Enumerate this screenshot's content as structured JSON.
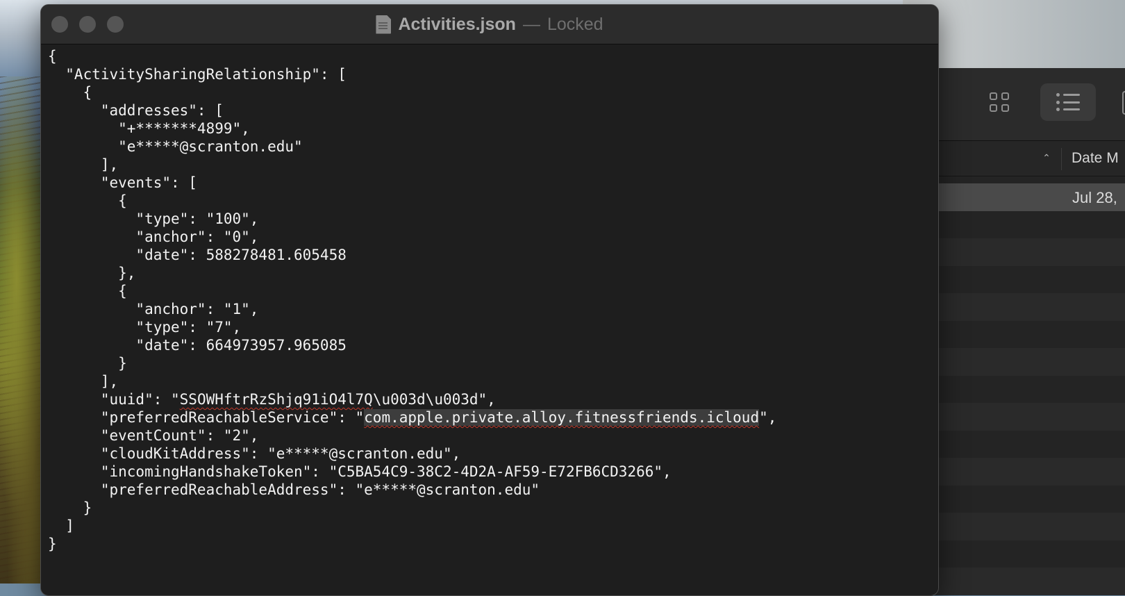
{
  "window": {
    "file_name": "Activities.json",
    "separator": "—",
    "state": "Locked",
    "icon": "document-icon"
  },
  "document": {
    "lines": [
      "{",
      "  \"ActivitySharingRelationship\": [",
      "    {",
      "      \"addresses\": [",
      "        \"+*******4899\",",
      "        \"e*****@scranton.edu\"",
      "      ],",
      "      \"events\": [",
      "        {",
      "          \"type\": \"100\",",
      "          \"anchor\": \"0\",",
      "          \"date\": 588278481.605458",
      "        },",
      "        {",
      "          \"anchor\": \"1\",",
      "          \"type\": \"7\",",
      "          \"date\": 664973957.965085",
      "        }",
      "      ],",
      "      \"uuid\": \"SSOWHftrRzShjq91iO4l7Q\\u003d\\u003d\",",
      "      \"preferredReachableService\": \"com.apple.private.alloy.fitnessfriends.icloud\",",
      "      \"eventCount\": \"2\",",
      "      \"cloudKitAddress\": \"e*****@scranton.edu\",",
      "      \"incomingHandshakeToken\": \"C5BA54C9-38C2-4D2A-AF59-E72FB6CD3266\",",
      "      \"preferredReachableAddress\": \"e*****@scranton.edu\"",
      "    }",
      "  ]",
      "}"
    ],
    "uuid_line": {
      "prefix": "      \"uuid\": \"",
      "misspelled": "SSOWHftrRzShjq91iO4l7Q",
      "suffix": "\\u003d\\u003d\","
    },
    "service_line": {
      "prefix": "      \"preferredReachableService\": \"",
      "selected": "com.apple.private.alloy.fitnessfriends.icloud",
      "suffix": "\","
    }
  },
  "finder": {
    "toolbar": {
      "grid_view_icon": "grid-view-icon",
      "list_view_icon": "list-view-icon"
    },
    "header": {
      "sort_icon": "chevron-up-icon",
      "date_column": "Date M"
    },
    "rows": [
      {
        "date": "Jul 28,"
      }
    ]
  },
  "colors": {
    "editor_bg": "#1e1e1e",
    "text": "#f2f2f2",
    "spell_error": "#c0392b"
  }
}
